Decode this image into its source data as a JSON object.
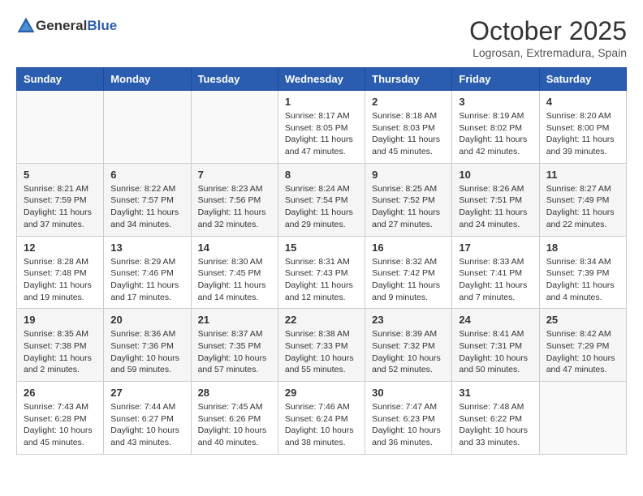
{
  "header": {
    "logo_general": "General",
    "logo_blue": "Blue",
    "title": "October 2025",
    "subtitle": "Logrosan, Extremadura, Spain"
  },
  "weekdays": [
    "Sunday",
    "Monday",
    "Tuesday",
    "Wednesday",
    "Thursday",
    "Friday",
    "Saturday"
  ],
  "weeks": [
    [
      {
        "day": "",
        "info": ""
      },
      {
        "day": "",
        "info": ""
      },
      {
        "day": "",
        "info": ""
      },
      {
        "day": "1",
        "info": "Sunrise: 8:17 AM\nSunset: 8:05 PM\nDaylight: 11 hours and 47 minutes."
      },
      {
        "day": "2",
        "info": "Sunrise: 8:18 AM\nSunset: 8:03 PM\nDaylight: 11 hours and 45 minutes."
      },
      {
        "day": "3",
        "info": "Sunrise: 8:19 AM\nSunset: 8:02 PM\nDaylight: 11 hours and 42 minutes."
      },
      {
        "day": "4",
        "info": "Sunrise: 8:20 AM\nSunset: 8:00 PM\nDaylight: 11 hours and 39 minutes."
      }
    ],
    [
      {
        "day": "5",
        "info": "Sunrise: 8:21 AM\nSunset: 7:59 PM\nDaylight: 11 hours and 37 minutes."
      },
      {
        "day": "6",
        "info": "Sunrise: 8:22 AM\nSunset: 7:57 PM\nDaylight: 11 hours and 34 minutes."
      },
      {
        "day": "7",
        "info": "Sunrise: 8:23 AM\nSunset: 7:56 PM\nDaylight: 11 hours and 32 minutes."
      },
      {
        "day": "8",
        "info": "Sunrise: 8:24 AM\nSunset: 7:54 PM\nDaylight: 11 hours and 29 minutes."
      },
      {
        "day": "9",
        "info": "Sunrise: 8:25 AM\nSunset: 7:52 PM\nDaylight: 11 hours and 27 minutes."
      },
      {
        "day": "10",
        "info": "Sunrise: 8:26 AM\nSunset: 7:51 PM\nDaylight: 11 hours and 24 minutes."
      },
      {
        "day": "11",
        "info": "Sunrise: 8:27 AM\nSunset: 7:49 PM\nDaylight: 11 hours and 22 minutes."
      }
    ],
    [
      {
        "day": "12",
        "info": "Sunrise: 8:28 AM\nSunset: 7:48 PM\nDaylight: 11 hours and 19 minutes."
      },
      {
        "day": "13",
        "info": "Sunrise: 8:29 AM\nSunset: 7:46 PM\nDaylight: 11 hours and 17 minutes."
      },
      {
        "day": "14",
        "info": "Sunrise: 8:30 AM\nSunset: 7:45 PM\nDaylight: 11 hours and 14 minutes."
      },
      {
        "day": "15",
        "info": "Sunrise: 8:31 AM\nSunset: 7:43 PM\nDaylight: 11 hours and 12 minutes."
      },
      {
        "day": "16",
        "info": "Sunrise: 8:32 AM\nSunset: 7:42 PM\nDaylight: 11 hours and 9 minutes."
      },
      {
        "day": "17",
        "info": "Sunrise: 8:33 AM\nSunset: 7:41 PM\nDaylight: 11 hours and 7 minutes."
      },
      {
        "day": "18",
        "info": "Sunrise: 8:34 AM\nSunset: 7:39 PM\nDaylight: 11 hours and 4 minutes."
      }
    ],
    [
      {
        "day": "19",
        "info": "Sunrise: 8:35 AM\nSunset: 7:38 PM\nDaylight: 11 hours and 2 minutes."
      },
      {
        "day": "20",
        "info": "Sunrise: 8:36 AM\nSunset: 7:36 PM\nDaylight: 10 hours and 59 minutes."
      },
      {
        "day": "21",
        "info": "Sunrise: 8:37 AM\nSunset: 7:35 PM\nDaylight: 10 hours and 57 minutes."
      },
      {
        "day": "22",
        "info": "Sunrise: 8:38 AM\nSunset: 7:33 PM\nDaylight: 10 hours and 55 minutes."
      },
      {
        "day": "23",
        "info": "Sunrise: 8:39 AM\nSunset: 7:32 PM\nDaylight: 10 hours and 52 minutes."
      },
      {
        "day": "24",
        "info": "Sunrise: 8:41 AM\nSunset: 7:31 PM\nDaylight: 10 hours and 50 minutes."
      },
      {
        "day": "25",
        "info": "Sunrise: 8:42 AM\nSunset: 7:29 PM\nDaylight: 10 hours and 47 minutes."
      }
    ],
    [
      {
        "day": "26",
        "info": "Sunrise: 7:43 AM\nSunset: 6:28 PM\nDaylight: 10 hours and 45 minutes."
      },
      {
        "day": "27",
        "info": "Sunrise: 7:44 AM\nSunset: 6:27 PM\nDaylight: 10 hours and 43 minutes."
      },
      {
        "day": "28",
        "info": "Sunrise: 7:45 AM\nSunset: 6:26 PM\nDaylight: 10 hours and 40 minutes."
      },
      {
        "day": "29",
        "info": "Sunrise: 7:46 AM\nSunset: 6:24 PM\nDaylight: 10 hours and 38 minutes."
      },
      {
        "day": "30",
        "info": "Sunrise: 7:47 AM\nSunset: 6:23 PM\nDaylight: 10 hours and 36 minutes."
      },
      {
        "day": "31",
        "info": "Sunrise: 7:48 AM\nSunset: 6:22 PM\nDaylight: 10 hours and 33 minutes."
      },
      {
        "day": "",
        "info": ""
      }
    ]
  ]
}
